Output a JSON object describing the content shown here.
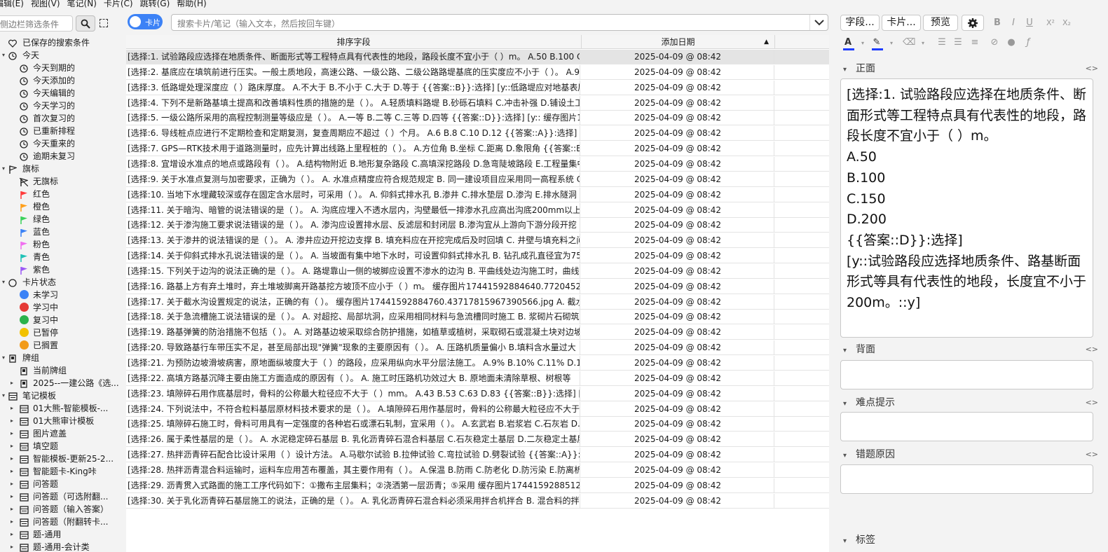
{
  "menu": [
    "编辑(E)",
    "视图(V)",
    "笔记(N)",
    "卡片(C)",
    "跳转(G)",
    "帮助(H)"
  ],
  "sidebar": {
    "search_placeholder": "侧边栏筛选条件",
    "items": [
      {
        "label": "已保存的搜索条件",
        "icon": "heart-icon"
      },
      {
        "label": "今天",
        "icon": "clock-icon",
        "arrow": "▾"
      },
      {
        "label": "今天到期的",
        "icon": "clock-icon"
      },
      {
        "label": "今天添加的",
        "icon": "clock-icon"
      },
      {
        "label": "今天编辑的",
        "icon": "clock-icon"
      },
      {
        "label": "今天学习的",
        "icon": "clock-icon"
      },
      {
        "label": "首次复习的",
        "icon": "clock-icon"
      },
      {
        "label": "已重新排程",
        "icon": "clock-icon"
      },
      {
        "label": "今天重来的",
        "icon": "clock-icon"
      },
      {
        "label": "逾期未复习",
        "icon": "clock-icon"
      },
      {
        "label": "旗标",
        "icon": "flag-icon",
        "arrow": "▾"
      },
      {
        "label": "无旗标",
        "icon": "no-flag-icon"
      },
      {
        "label": "红色",
        "icon": "red-flag-icon",
        "color": "#ff3b3b"
      },
      {
        "label": "橙色",
        "icon": "orange-flag-icon",
        "color": "#ff9f1a"
      },
      {
        "label": "绿色",
        "icon": "green-flag-icon",
        "color": "#3bd15a"
      },
      {
        "label": "蓝色",
        "icon": "blue-flag-icon",
        "color": "#3b82f6"
      },
      {
        "label": "粉色",
        "icon": "pink-flag-icon",
        "color": "#f06ff0"
      },
      {
        "label": "青色",
        "icon": "turquoise-flag-icon",
        "color": "#1fc2b6"
      },
      {
        "label": "紫色",
        "icon": "purple-flag-icon",
        "color": "#9b59f6"
      },
      {
        "label": "卡片状态",
        "icon": "circle-icon",
        "arrow": "▾"
      },
      {
        "label": "未学习",
        "icon": "new-dot-icon",
        "color": "#3b82f6"
      },
      {
        "label": "学习中",
        "icon": "learning-dot-icon",
        "color": "#e53935"
      },
      {
        "label": "复习中",
        "icon": "review-dot-icon",
        "color": "#2bb24c"
      },
      {
        "label": "已暂停",
        "icon": "suspended-dot-icon",
        "color": "#f2c200"
      },
      {
        "label": "已搁置",
        "icon": "buried-dot-icon",
        "color": "#f29b1a"
      },
      {
        "label": "牌组",
        "icon": "deck-icon",
        "arrow": "▾"
      },
      {
        "label": "当前牌组",
        "icon": "current-deck-icon"
      },
      {
        "label": "2025--一建公路《选...",
        "icon": "deck-icon",
        "arrow": "▸"
      },
      {
        "label": "笔记模板",
        "icon": "notetype-icon",
        "arrow": "▾"
      },
      {
        "label": "01大熊-智能模板-...",
        "icon": "notetype-icon",
        "arrow": "▸"
      },
      {
        "label": "01大熊审计模板",
        "icon": "notetype-icon",
        "arrow": "▸"
      },
      {
        "label": "图片遮盖",
        "icon": "notetype-icon",
        "arrow": "▸"
      },
      {
        "label": "填空题",
        "icon": "notetype-icon",
        "arrow": "▸"
      },
      {
        "label": "智能模板-更新25-2...",
        "icon": "notetype-icon",
        "arrow": "▸"
      },
      {
        "label": "智能题卡-King咔",
        "icon": "notetype-icon",
        "arrow": "▸"
      },
      {
        "label": "问答题",
        "icon": "notetype-icon",
        "arrow": "▸"
      },
      {
        "label": "问答题（可选附翻...",
        "icon": "notetype-icon",
        "arrow": "▸"
      },
      {
        "label": "问答题（输入答案）",
        "icon": "notetype-icon",
        "arrow": "▸"
      },
      {
        "label": "问答题（附翻转卡...",
        "icon": "notetype-icon",
        "arrow": "▸"
      },
      {
        "label": "题-通用",
        "icon": "notetype-icon",
        "arrow": "▸"
      },
      {
        "label": "题-通用-会计类",
        "icon": "notetype-icon",
        "arrow": "▸"
      }
    ]
  },
  "toggle_label": "卡片",
  "search": {
    "placeholder": "搜索卡片/笔记（输入文本，然后按回车键）"
  },
  "columns": {
    "sort_field": "排序字段",
    "added": "添加日期",
    "sort_indicator": "▲"
  },
  "rows": [
    {
      "text": "[选择:1. 试验路段应选择在地质条件、断面形式等工程特点具有代表性的地段，路段长度不宜小于（ ）m。 A.50  B.100  C.150  D.200",
      "date": "2025-04-09 @ 08:42"
    },
    {
      "text": "[选择:2. 基底应在填筑前进行压实。一般土质地段，高速公路、一级公路、二级公路路堤基底的压实度应不小于（ ）。 A.90%  B.92%",
      "date": "2025-04-09 @ 08:42"
    },
    {
      "text": "[选择:3. 低路堤处理深度应（ ）路床厚度。 A.不大于  B.不小于  C.大于  D.等于 {{答案::B}}:选择] [y::低路堤应对地基表层土进行处理",
      "date": "2025-04-09 @ 08:42"
    },
    {
      "text": "[选择:4. 下列不是新路基填土提高和改善填料性质的措施的是（ ）。 A.轻质填料路堤  B.砂砾石填料  C.冲击补强  D.铺设土工合成材料",
      "date": "2025-04-09 @ 08:42"
    },
    {
      "text": "[选择:5. 一级公路所采用的高程控制测量等级应是（ ）。 A.一等  B.二等  C.三等  D.四等 {{答案::D}}:选择] [y:: 缓存图片17441592884",
      "date": "2025-04-09 @ 08:42"
    },
    {
      "text": "[选择:6. 导线桩点应进行不定期检查和定期复测，复查周期应不超过（ ）个月。 A.6  B.8  C.10  D.12 {{答案::A}}:选择] [y::导线",
      "date": "2025-04-09 @ 08:42"
    },
    {
      "text": "[选择:7. GPS—RTK技术用于道路测量时，应先计算出线路上里程桩的（ ）。 A.方位角  B.坐标  C.距离  D.象限角 {{答案::B}}:选择]",
      "date": "2025-04-09 @ 08:42"
    },
    {
      "text": "[选择:8. 宜增设水准点的地点或路段有（ ）。 A.结构物附近  B.地形复杂路段  C.高填深挖路段  D.急弯陡坡路段  E.工程量集中路段",
      "date": "2025-04-09 @ 08:42"
    },
    {
      "text": "[选择:9. 关于水准点复测与加密要求，正确为（ ）。 A. 水准点精度应符合规范规定  B. 同一建设项目应采用同一高程系统  C. 应与相邻",
      "date": "2025-04-09 @ 08:42"
    },
    {
      "text": "[选择:10. 当地下水埋藏较深或存在固定含水层时，可采用（ ）。 A. 仰斜式排水孔  B.渗井  C.排水垫层  D.渗沟  E.排水隧洞",
      "date": "2025-04-09 @ 08:42"
    },
    {
      "text": "[选择:11. 关于暗沟、暗管的说法错误的是（ ）。 A. 沟底应埋入不透水层内，沟壁最低一排渗水孔应高出沟底200mm以上",
      "date": "2025-04-09 @ 08:42"
    },
    {
      "text": "[选择:12. 关于渗沟施工要求说法错误的是（ ）。 A. 渗沟应设置排水层、反滤层和封闭层  B.渗沟宜从上游向下游分段开挖",
      "date": "2025-04-09 @ 08:42"
    },
    {
      "text": "[选择:13. 关于渗井的说法错误的是（ ）。 A. 渗井应边开挖边支撑  B. 填充料应在开挖完成后及时回填  C. 井壁与填充料之间应设反滤层",
      "date": "2025-04-09 @ 08:42"
    },
    {
      "text": "[选择:14. 关于仰斜式排水孔说法错误的是（ ）。 A. 当坡面有集中地下水时，可设置仰斜式排水孔  B. 钻孔成孔直径宜为75~150mm",
      "date": "2025-04-09 @ 08:42"
    },
    {
      "text": "[选择:15. 下列关于边沟的说法正确的是（ ）。 A. 路堤靠山一侧的坡脚应设置不渗水的边沟  B. 平曲线处边沟施工时，曲线内侧",
      "date": "2025-04-09 @ 08:42"
    },
    {
      "text": "[选择:16. 路基上方有弃土堆时，弃土堆坡脚离开路基挖方坡顶不应小于（ ）m。 缓存图片17441592884640.7720452169",
      "date": "2025-04-09 @ 08:42"
    },
    {
      "text": "[选择:17. 关于截水沟设置规定的说法，正确的有（ ）。 缓存图片17441592884760.43717815967390566.jpg A. 截水沟长度超过",
      "date": "2025-04-09 @ 08:42"
    },
    {
      "text": "[选择:18. 关于急流槽施工说法错误的是（ ）。 A. 对超挖、局部坑洞，应采用相同材料与急流槽同时施工  B. 浆砌片石砌筑",
      "date": "2025-04-09 @ 08:42"
    },
    {
      "text": "[选择:19. 路基弹簧的防治措施不包括（ ）。 A. 对路基边坡采取综合防护措施，如植草或植树，采取砌石或混凝土块对边坡",
      "date": "2025-04-09 @ 08:42"
    },
    {
      "text": "[选择:20. 导致路基行车带压实不足，甚至局部出现\"弹簧\"现象的主要原因有（ ）。 A. 压路机质量偏小  B.填料含水量过大",
      "date": "2025-04-09 @ 08:42"
    },
    {
      "text": "[选择:21. 为预防边坡滑坡病害，原地面纵坡度大于（ ）的路段，应采用纵向水平分层法施工。 A.9%  B.10%  C.11%  D.12%",
      "date": "2025-04-09 @ 08:42"
    },
    {
      "text": "[选择:22. 高填方路基沉降主要由施工方面造成的原因有（ ）。 A. 施工时压路机功效过大  B. 原地面未清除草根、树根等",
      "date": "2025-04-09 @ 08:42"
    },
    {
      "text": "[选择:23. 填隙碎石用作底基层时，骨料的公称最大粒径应不大于（ ）mm。 A.43  B.53  C.63  D.83 {{答案::B}}:选择] [y::",
      "date": "2025-04-09 @ 08:42"
    },
    {
      "text": "[选择:24. 下列说法中，不符合粒料基层原材料技术要求的是（ ）。 A.填隙碎石用作基层时，骨料的公称最大粒径应不大于53mm",
      "date": "2025-04-09 @ 08:42"
    },
    {
      "text": "[选择:25. 填隙碎石施工时，骨料可用具有一定强度的各种岩石或漂石轧制，宜采用（ ）。 A.玄武岩  B.岩浆岩  C.石灰岩  D.花岗岩",
      "date": "2025-04-09 @ 08:42"
    },
    {
      "text": "[选择:26. 属于柔性基层的是（ ）。 A. 水泥稳定碎石基层  B. 乳化沥青碎石混合料基层  C.石灰稳定土基层  D.二灰稳定土基层",
      "date": "2025-04-09 @ 08:42"
    },
    {
      "text": "[选择:27. 热拌沥青碎石配合比设计采用（ ）设计方法。 A.马歇尔试验  B.拉伸试验  C.弯拉试验  D.劈裂试验 {{答案::A}}:选择]",
      "date": "2025-04-09 @ 08:42"
    },
    {
      "text": "[选择:28. 热拌沥青混合料运输时，运料车应用苫布覆盖，其主要作用有（ ）。 A.保温  B.防雨  C.防老化  D.防污染  E.防离析",
      "date": "2025-04-09 @ 08:42"
    },
    {
      "text": "[选择:29. 沥青贯入式路面的施工工序代码如下：①撒布主层集料；②浇洒第一层沥青；⑤采用 缓存图片17441592885120.3",
      "date": "2025-04-09 @ 08:42"
    },
    {
      "text": "[选择:30. 关于乳化沥青碎石基层施工的说法，正确的是（ ）。 A. 乳化沥青碎石混合料必须采用拌合机拌合  B. 混合料的拌合",
      "date": "2025-04-09 @ 08:42"
    }
  ],
  "editor": {
    "toolbar": {
      "fields": "字段...",
      "cards": "卡片...",
      "preview": "预览"
    },
    "fields": [
      {
        "name": "正面",
        "content": [
          "[选择:1. 试验路段应选择在地质条件、断面形式等工程特点具有代表性的地段，路段长度不宜小于（ ）m。",
          "A.50",
          "B.100",
          "C.150",
          "D.200",
          "{{答案::D}}:选择]",
          "[y::试验路段应选择地质条件、路基断面形式等具有代表性的地段，长度宜不小于200m。::y]"
        ]
      },
      {
        "name": "背面",
        "content": []
      },
      {
        "name": "难点提示",
        "content": []
      },
      {
        "name": "错题原因",
        "content": []
      }
    ],
    "tags_label": "标签",
    "code_toggle": "<>"
  }
}
